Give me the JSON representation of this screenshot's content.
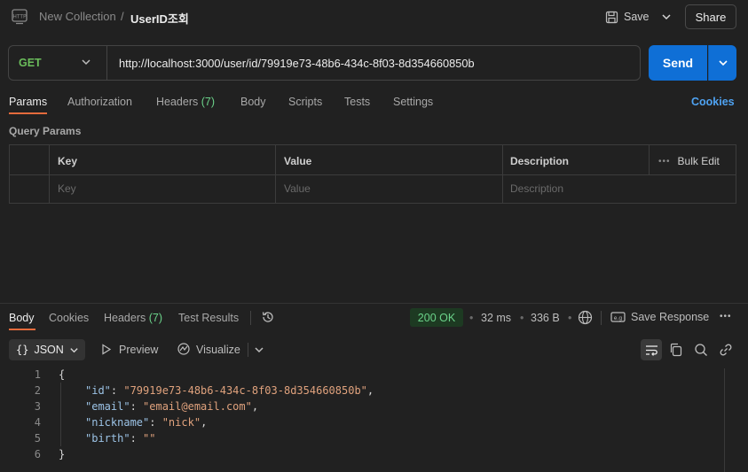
{
  "header": {
    "breadcrumb_parent": "New Collection",
    "breadcrumb_sep": "/",
    "request_name": "UserID조회",
    "save_label": "Save",
    "share_label": "Share"
  },
  "request": {
    "method": "GET",
    "url": "http://localhost:3000/user/id/79919e73-48b6-434c-8f03-8d354660850b",
    "send_label": "Send"
  },
  "request_tabs": [
    "Params",
    "Authorization",
    "Headers",
    "Body",
    "Scripts",
    "Tests",
    "Settings"
  ],
  "headers_count": "(7)",
  "cookies_link": "Cookies",
  "query_params": {
    "title": "Query Params",
    "columns": [
      "Key",
      "Value",
      "Description"
    ],
    "bulk_edit": "Bulk Edit",
    "placeholders": [
      "Key",
      "Value",
      "Description"
    ]
  },
  "response": {
    "tabs": [
      "Body",
      "Cookies",
      "Headers",
      "Test Results"
    ],
    "headers_count": "(7)",
    "status": "200 OK",
    "time": "32 ms",
    "size": "336 B",
    "save_response": "Save Response",
    "format": "JSON",
    "preview": "Preview",
    "visualize": "Visualize",
    "lines": [
      {
        "n": "1",
        "open": "{"
      },
      {
        "n": "2",
        "key": "\"id\"",
        "val": "\"79919e73-48b6-434c-8f03-8d354660850b\"",
        "comma": ","
      },
      {
        "n": "3",
        "key": "\"email\"",
        "val": "\"email@email.com\"",
        "comma": ","
      },
      {
        "n": "4",
        "key": "\"nickname\"",
        "val": "\"nick\"",
        "comma": ","
      },
      {
        "n": "5",
        "key": "\"birth\"",
        "val": "\"\"",
        "comma": ""
      },
      {
        "n": "6",
        "open": "}"
      }
    ]
  },
  "colors": {
    "accent": "#e46b3c",
    "send": "#0f6fd6",
    "method_get": "#6bbd5b",
    "status_ok": "#6bd38a"
  }
}
